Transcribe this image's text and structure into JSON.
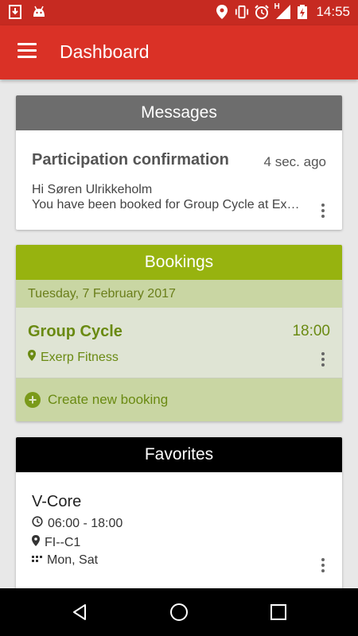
{
  "status_bar": {
    "left_icons": [
      "download-icon",
      "android-icon"
    ],
    "right_icons": [
      "location-pin-icon",
      "vibrate-icon",
      "alarm-icon",
      "signal-icon",
      "battery-charging-icon"
    ],
    "network": "H",
    "time": "14:55"
  },
  "app_bar": {
    "title": "Dashboard",
    "menu_icon": "hamburger-menu-icon",
    "background": "#da3126"
  },
  "messages": {
    "header": "Messages",
    "header_color": "#6d6d6d",
    "item": {
      "title": "Participation confirmation",
      "time": "4 sec. ago",
      "line1": "Hi Søren Ulrikkeholm",
      "line2": "You have been booked for Group Cycle at Exerp Fitness"
    }
  },
  "bookings": {
    "header": "Bookings",
    "header_color": "#97b30f",
    "date": "Tuesday, 7 February 2017",
    "item": {
      "name": "Group Cycle",
      "time": "18:00",
      "location": "Exerp Fitness"
    },
    "create_label": "Create new booking"
  },
  "favorites": {
    "header": "Favorites",
    "header_color": "#000000",
    "item": {
      "name": "V-Core",
      "time_range": "06:00 - 18:00",
      "location": "FI--C1",
      "days": "Mon, Sat"
    }
  },
  "nav_bar": {
    "buttons": [
      "back-icon",
      "home-icon",
      "recents-icon"
    ]
  }
}
